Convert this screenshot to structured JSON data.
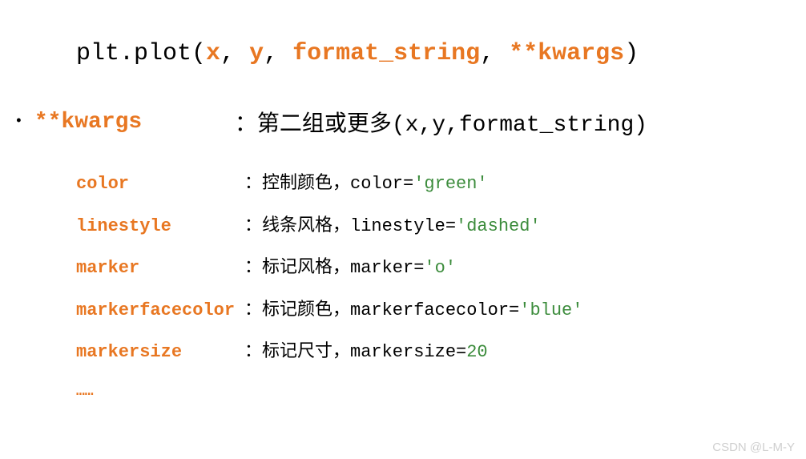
{
  "signature": {
    "prefix": "plt.plot(",
    "x": "x",
    "sep1": ", ",
    "y": "y",
    "sep2": ", ",
    "fmt": "format_string",
    "sep3": ", ",
    "kwargs": "**kwargs",
    "suffix": ")"
  },
  "kwargs_row": {
    "label": "**kwargs",
    "desc": "：第二组或更多(x,y,format_string)"
  },
  "params": [
    {
      "name": "color",
      "desc_cn": "：控制颜色，color=",
      "value": "'green'",
      "after": ""
    },
    {
      "name": "linestyle",
      "desc_cn": "：线条风格，linestyle=",
      "value": "'dashed'",
      "after": ""
    },
    {
      "name": "marker",
      "desc_cn": "：标记风格，marker=",
      "value": "'o'",
      "after": ""
    },
    {
      "name": "markerfacecolor",
      "desc_cn": "：标记颜色，markerfacecolor=",
      "value": "'blue'",
      "after": ""
    },
    {
      "name": "markersize",
      "desc_cn": "：标记尺寸，markersize=",
      "value": "20",
      "after": ""
    }
  ],
  "ellipsis": "……",
  "watermark": "CSDN @L-M-Y"
}
